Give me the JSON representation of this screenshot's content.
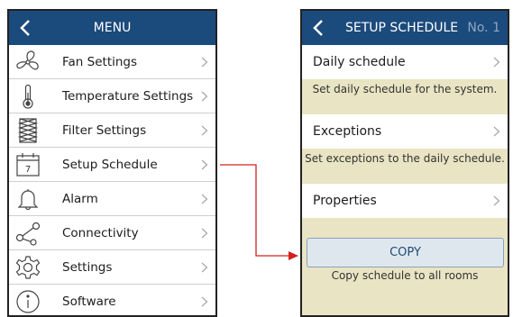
{
  "menu": {
    "title": "MENU",
    "items": [
      {
        "label": "Fan Settings",
        "icon": "fan-icon"
      },
      {
        "label": "Temperature Settings",
        "icon": "thermometer-icon"
      },
      {
        "label": "Filter Settings",
        "icon": "filter-icon"
      },
      {
        "label": "Setup Schedule",
        "icon": "calendar-icon"
      },
      {
        "label": "Alarm",
        "icon": "bell-icon"
      },
      {
        "label": "Connectivity",
        "icon": "share-icon"
      },
      {
        "label": "Settings",
        "icon": "gear-icon"
      },
      {
        "label": "Software",
        "icon": "info-icon"
      }
    ]
  },
  "calendar_day": "7",
  "schedule": {
    "title": "SETUP SCHEDULE",
    "number": "No. 1",
    "items": [
      {
        "label": "Daily schedule",
        "description": "Set daily schedule for the system."
      },
      {
        "label": "Exceptions",
        "description": "Set exceptions to the daily schedule."
      },
      {
        "label": "Properties"
      }
    ],
    "copy_label": "COPY",
    "copy_description": "Copy schedule to all rooms"
  },
  "colors": {
    "header": "#1b4a7c",
    "panel_bg": "#e9e4c3",
    "arrow": "#d42020"
  }
}
